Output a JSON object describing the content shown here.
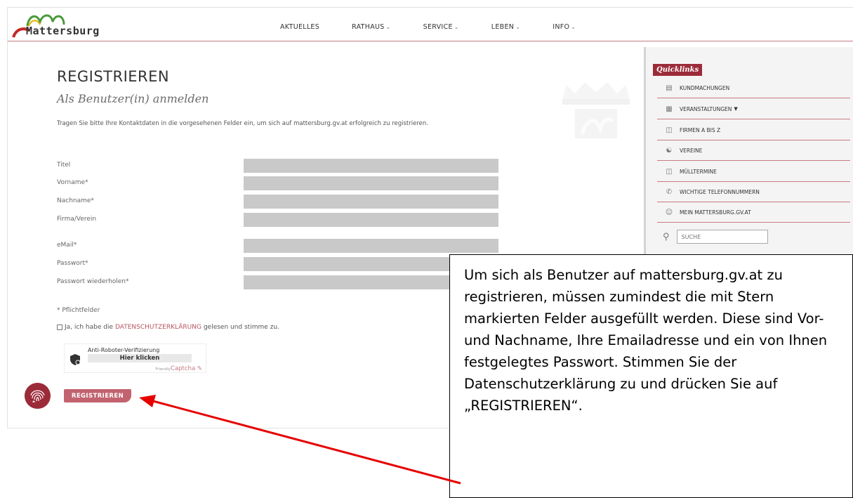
{
  "header": {
    "logo_text": "Mattersburg",
    "nav": [
      {
        "label": "AKTUELLES",
        "chevron": false
      },
      {
        "label": "RATHAUS",
        "chevron": true
      },
      {
        "label": "SERVICE",
        "chevron": true
      },
      {
        "label": "LEBEN",
        "chevron": true
      },
      {
        "label": "INFO",
        "chevron": true
      }
    ]
  },
  "main": {
    "title": "REGISTRIEREN",
    "subtitle": "Als Benutzer(in) anmelden",
    "intro": "Tragen Sie bitte Ihre Kontaktdaten in die vorgesehenen Felder ein, um sich auf mattersburg.gv.at erfolgreich zu registrieren.",
    "fields": {
      "titel": "Titel",
      "vorname": "Vorname*",
      "nachname": "Nachname*",
      "firma": "Firma/Verein",
      "email": "eMail*",
      "passwort": "Passwort*",
      "passwort2": "Passwort wiederholen*"
    },
    "required_note": "* Pflichtfelder",
    "consent": {
      "before": "Ja, ich habe die",
      "link": "DATENSCHUTZERKLÄRUNG",
      "after": "gelesen und stimme zu."
    },
    "captcha": {
      "title": "Anti-Roboter-Verifizierung",
      "button": "Hier klicken",
      "brand_small": "Friendly",
      "brand": "Captcha"
    },
    "submit_label": "REGISTRIEREN"
  },
  "sidebar": {
    "heading": "Quicklinks",
    "items": [
      {
        "label": "KUNDMACHUNGEN",
        "icon": "announcement-icon"
      },
      {
        "label": "VERANSTALTUNGEN",
        "icon": "calendar-icon",
        "chevron": true
      },
      {
        "label": "FIRMEN A BIS Z",
        "icon": "directory-icon"
      },
      {
        "label": "VEREINE",
        "icon": "group-icon"
      },
      {
        "label": "MÜLLTERMINE",
        "icon": "trash-icon"
      },
      {
        "label": "WICHTIGE TELEFONNUMMERN",
        "icon": "phone-icon"
      },
      {
        "label": "MEIN MATTERSBURG.GV.AT",
        "icon": "user-icon"
      }
    ],
    "search_placeholder": "SUCHE"
  },
  "callout": {
    "text": "Um sich als Benutzer auf mattersburg.gv.at zu registrieren, müssen zumindest die mit Stern markierten Felder ausgefüllt werden. Diese sind Vor- und Nachname, Ihre Emailadresse und ein von Ihnen festgelegtes Passwort. Stimmen Sie der Datenschutzerklärung zu und drücken Sie auf „REGISTRIEREN“."
  },
  "colors": {
    "brand": "#9c2b39",
    "button": "#c2636f",
    "divider": "#c87b84",
    "field": "#c9c9c9",
    "arrow": "#e60000"
  }
}
